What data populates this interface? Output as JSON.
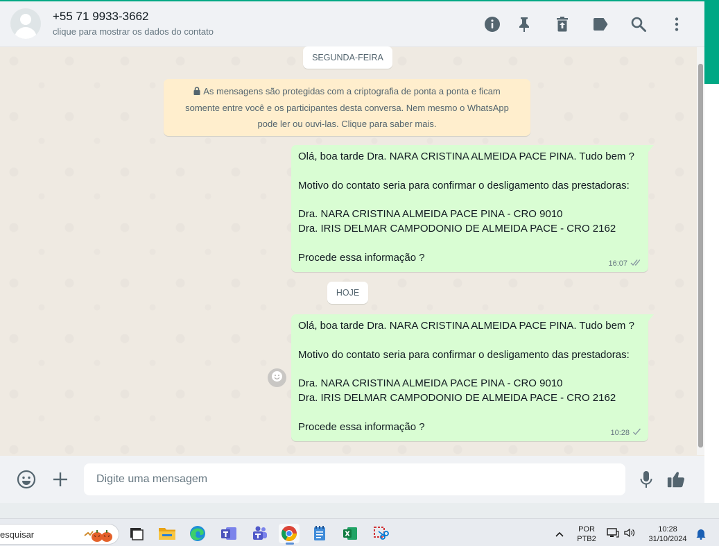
{
  "header": {
    "contact_name": "+55 71 9933-3662",
    "contact_subtitle": "clique para mostrar os dados do contato",
    "icons": [
      "info-icon",
      "pin-icon",
      "delete-icon",
      "label-icon",
      "search-icon",
      "menu-icon"
    ]
  },
  "chat": {
    "date_labels": [
      "SEGUNDA-FEIRA",
      "HOJE"
    ],
    "encryption_notice": {
      "line1": "As mensagens são protegidas com a criptografia de ponta a ponta e ficam",
      "line2": "somente entre você e os participantes desta conversa. Nem mesmo o WhatsApp",
      "line3": "pode ler ou ouvi-las. Clique para saber mais."
    },
    "messages": [
      {
        "lines": [
          "Olá, boa tarde Dra. NARA CRISTINA ALMEIDA PACE PINA. Tudo bem ?",
          "",
          "Motivo do contato seria para confirmar o desligamento das prestadoras:",
          "",
          "Dra. NARA CRISTINA ALMEIDA PACE PINA - CRO 9010",
          "Dra. IRIS DELMAR CAMPODONIO DE ALMEIDA PACE - CRO 2162",
          "",
          "Procede essa informação ?"
        ],
        "time": "16:07",
        "status": "read"
      },
      {
        "lines": [
          "Olá, boa tarde Dra. NARA CRISTINA ALMEIDA PACE PINA. Tudo bem ?",
          "",
          "Motivo do contato seria para confirmar o desligamento das prestadoras:",
          "",
          "Dra. NARA CRISTINA ALMEIDA PACE PINA - CRO 9010",
          "Dra. IRIS DELMAR CAMPODONIO DE ALMEIDA PACE - CRO 2162",
          "",
          "Procede essa informação ?"
        ],
        "time": "10:28",
        "status": "sent"
      }
    ]
  },
  "composer": {
    "placeholder": "Digite uma mensagem"
  },
  "taskbar": {
    "search_text": "esquisar",
    "apps": [
      "task-view",
      "file-explorer",
      "edge",
      "teams-work",
      "teams",
      "chrome",
      "notepad",
      "excel",
      "snipping-tool"
    ],
    "active_app": "chrome",
    "lang_line1": "POR",
    "lang_line2": "PTB2",
    "time": "10:28",
    "date": "31/10/2024"
  },
  "colors": {
    "accent": "#00a884",
    "outgoing_bubble": "#d9fdd3",
    "notice_bg": "#ffeecd",
    "read_ticks": "#8696a0",
    "chat_bg": "#efeae2"
  }
}
